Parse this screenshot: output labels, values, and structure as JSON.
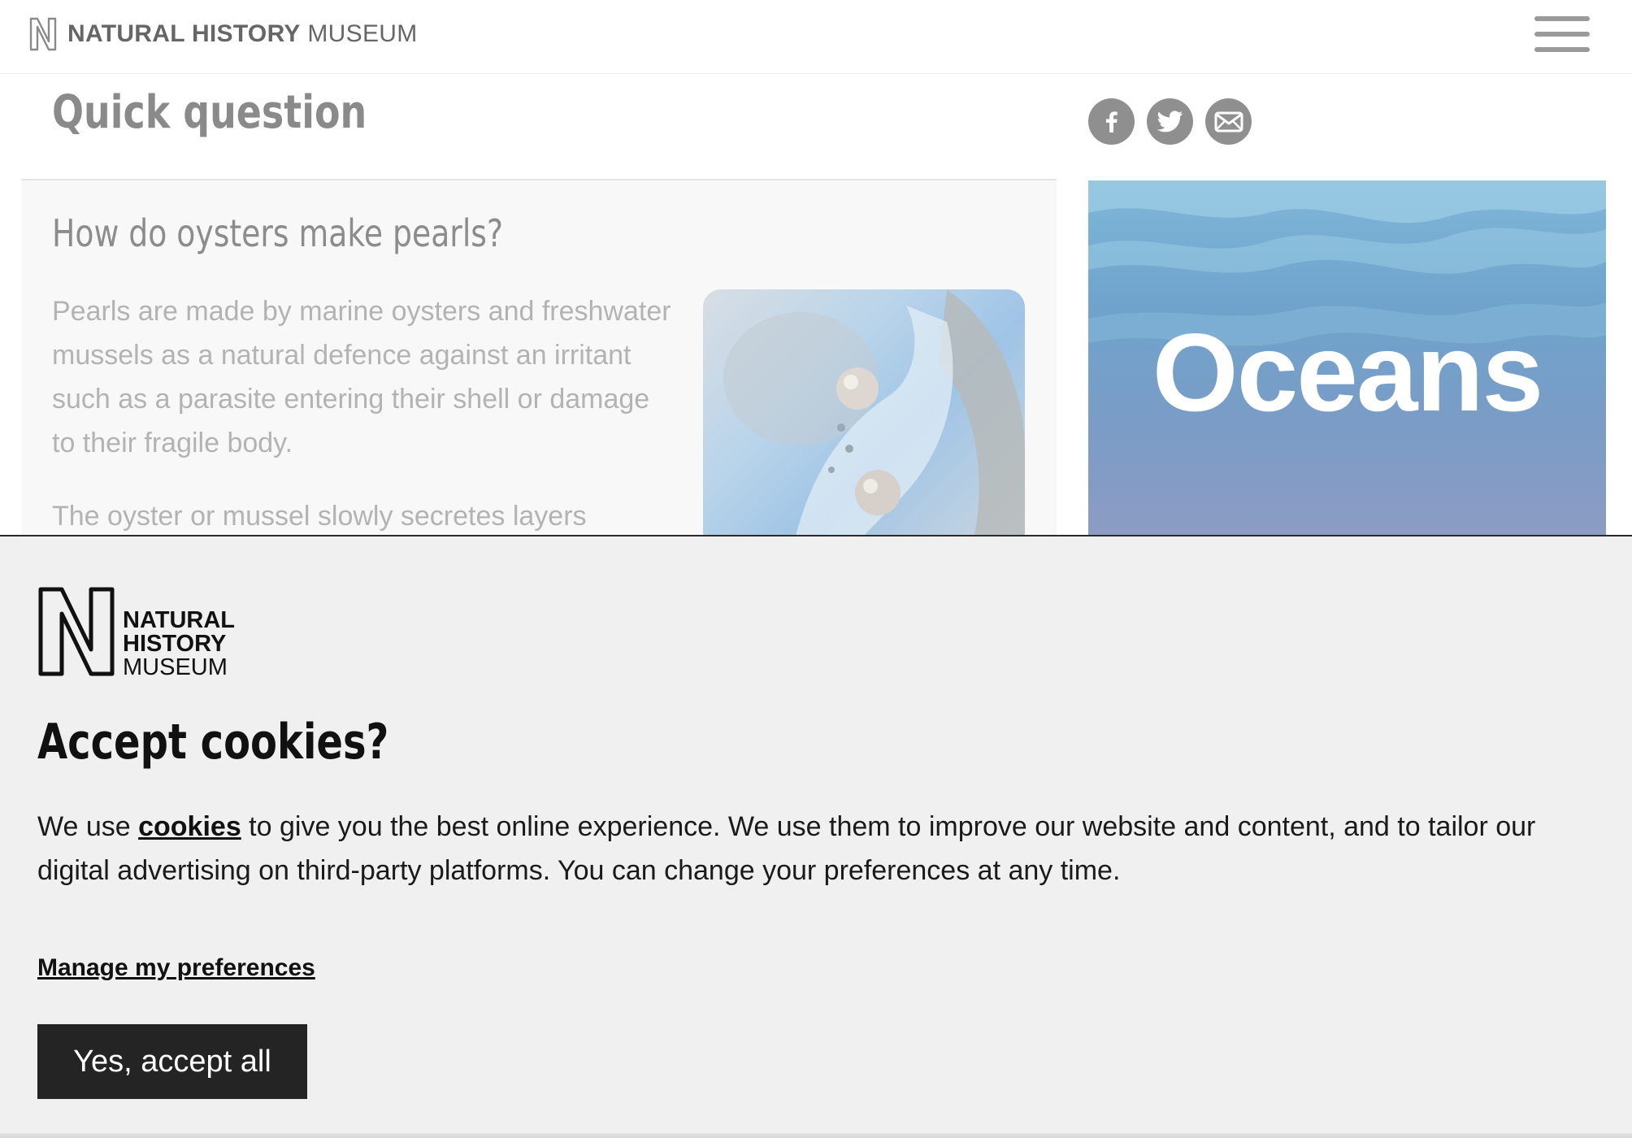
{
  "header": {
    "logo_bold": "NATURAL HISTORY",
    "logo_regular": "MUSEUM",
    "menu_icon": "hamburger-menu-icon"
  },
  "page": {
    "title": "Quick question",
    "share_icons": [
      "facebook-icon",
      "twitter-icon",
      "email-icon"
    ]
  },
  "qa": {
    "question": "How do oysters make pearls?",
    "answer_p1": "Pearls are made by marine oysters and freshwater mussels as a natural defence against an irritant such as a parasite entering their shell or damage to their fragile body.",
    "answer_p2": "The oyster or mussel slowly secretes layers"
  },
  "promo": {
    "title": "Oceans"
  },
  "cookie_banner": {
    "logo_line1": "NATURAL",
    "logo_line2": "HISTORY",
    "logo_line3": "MUSEUM",
    "title": "Accept cookies?",
    "text_before_link": "We use ",
    "link_text": "cookies",
    "text_after_link": " to give you the best online experience. We use them to improve our website and content, and to tailor our digital advertising on third-party platforms. You can change your preferences at any time.",
    "manage_label": "Manage my preferences",
    "accept_label": "Yes, accept all"
  },
  "colors": {
    "banner_bg": "#f0f0f0",
    "button_bg": "#242424",
    "dimmed_text": "#b3b3b3"
  }
}
